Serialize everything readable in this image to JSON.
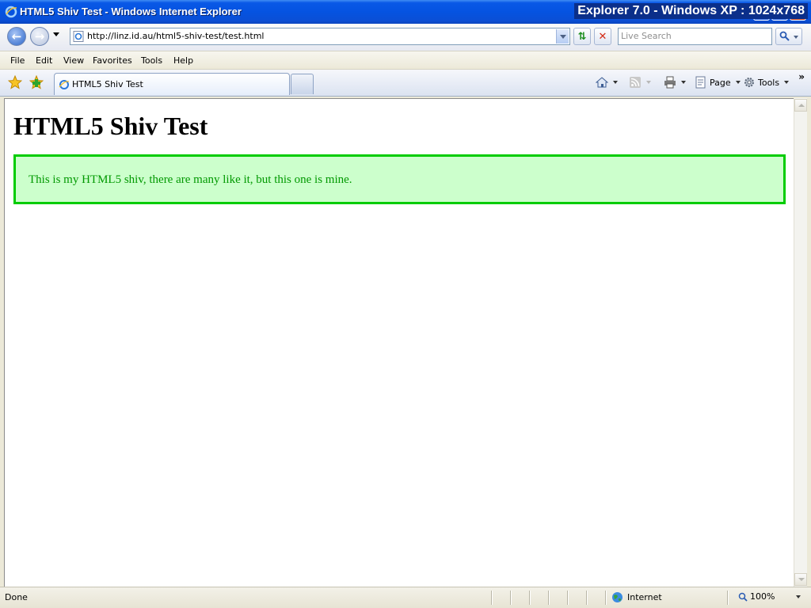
{
  "window": {
    "title": "HTML5 Shiv Test - Windows Internet Explorer",
    "overlay_label": "Explorer 7.0 - Windows XP : 1024x768"
  },
  "address": {
    "url": "http://linz.id.au/html5-shiv-test/test.html",
    "search_placeholder": "Live Search"
  },
  "menu": {
    "items": [
      "File",
      "Edit",
      "View",
      "Favorites",
      "Tools",
      "Help"
    ]
  },
  "tabs": {
    "active_label": "HTML5 Shiv Test"
  },
  "commands": {
    "page_label": "Page",
    "tools_label": "Tools",
    "more_label": "»"
  },
  "content": {
    "heading": "HTML5 Shiv Test",
    "message": "This is my HTML5 shiv, there are many like it, but this one is mine."
  },
  "status": {
    "text": "Done",
    "zone": "Internet",
    "zoom": "100%"
  },
  "colors": {
    "box_background": "#ccffcc",
    "box_border": "#00cc00",
    "message_text": "#009900",
    "titlebar": "#0553e1"
  },
  "icons": [
    "ie-logo-icon",
    "back-arrow-icon",
    "forward-arrow-icon",
    "page-icon",
    "refresh-icon",
    "stop-icon",
    "search-icon",
    "favorites-star-icon",
    "add-favorite-icon",
    "home-icon",
    "rss-feed-icon",
    "print-icon",
    "page-menu-icon",
    "tools-gear-icon",
    "internet-globe-icon",
    "zoom-icon"
  ]
}
